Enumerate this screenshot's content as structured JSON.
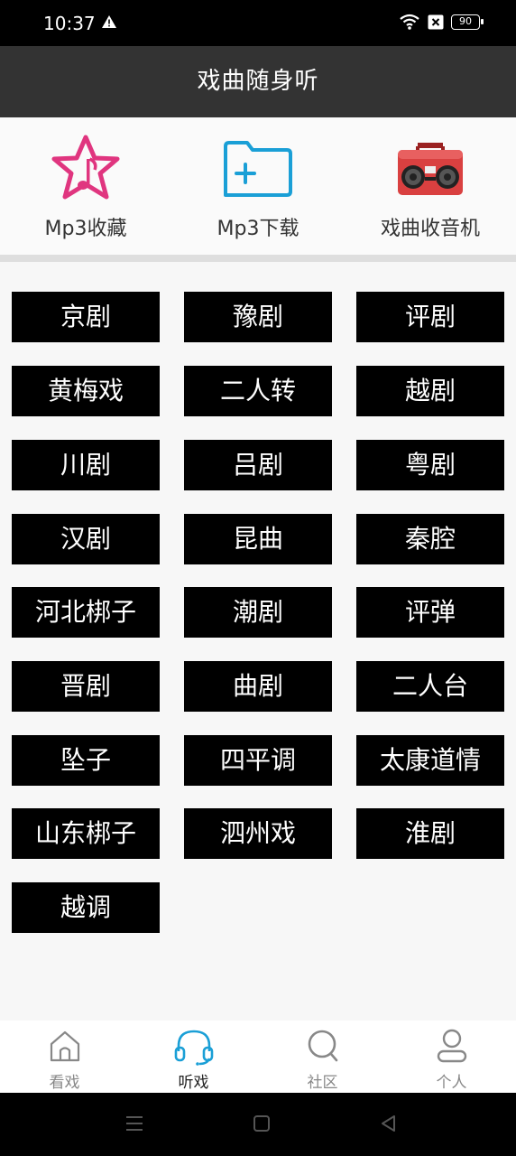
{
  "status": {
    "time": "10:37",
    "battery": "90"
  },
  "header": {
    "title": "戏曲随身听"
  },
  "features": [
    {
      "label": "Mp3收藏",
      "icon": "star-music-icon"
    },
    {
      "label": "Mp3下载",
      "icon": "folder-plus-icon"
    },
    {
      "label": "戏曲收音机",
      "icon": "radio-icon"
    }
  ],
  "genres": [
    "京剧",
    "豫剧",
    "评剧",
    "黄梅戏",
    "二人转",
    "越剧",
    "川剧",
    "吕剧",
    "粤剧",
    "汉剧",
    "昆曲",
    "秦腔",
    "河北梆子",
    "潮剧",
    "评弹",
    "晋剧",
    "曲剧",
    "二人台",
    "坠子",
    "四平调",
    "太康道情",
    "山东梆子",
    "泗州戏",
    "淮剧",
    "越调"
  ],
  "nav": [
    {
      "label": "看戏",
      "icon": "home-icon"
    },
    {
      "label": "听戏",
      "icon": "headphones-icon",
      "active": true
    },
    {
      "label": "社区",
      "icon": "search-icon"
    },
    {
      "label": "个人",
      "icon": "person-icon"
    }
  ],
  "colors": {
    "accent": "#1a9fd6",
    "star": "#e0357f",
    "radio": "#d94040"
  }
}
